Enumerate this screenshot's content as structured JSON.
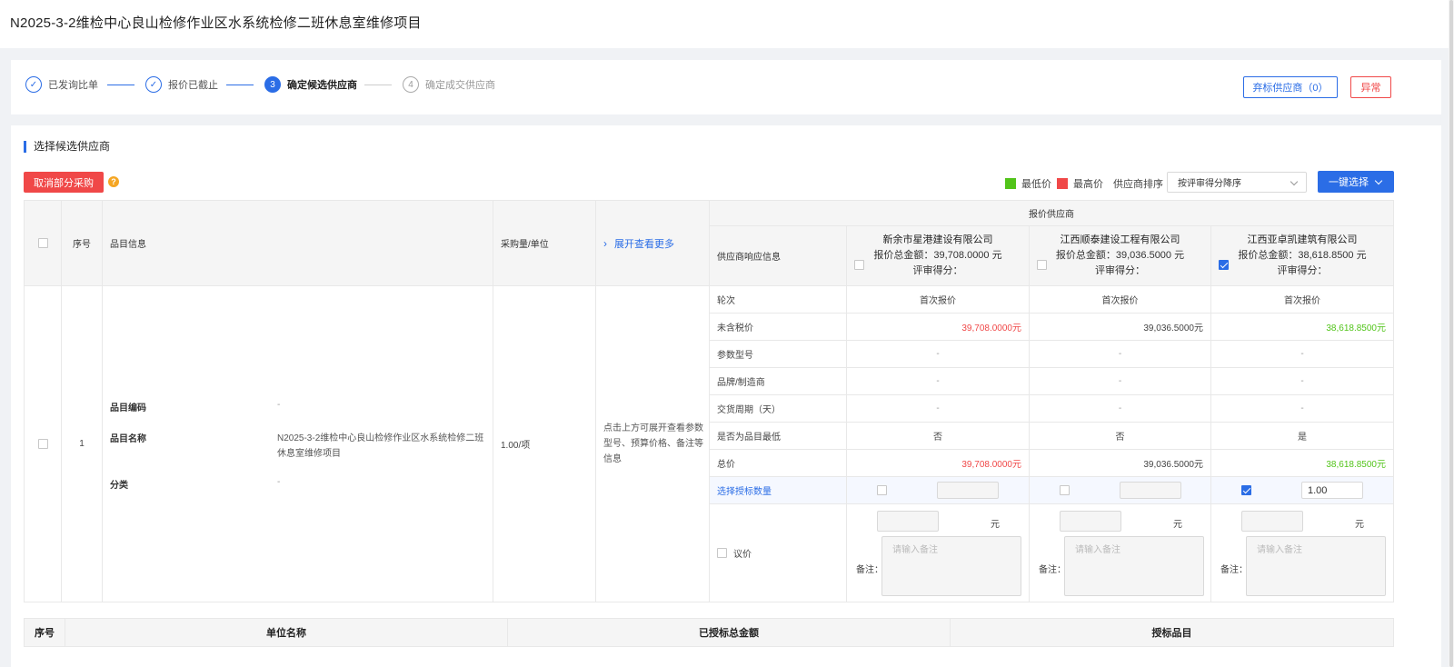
{
  "page": {
    "title": "N2025-3-2维检中心良山检修作业区水系统检修二班休息室维修项目"
  },
  "steps": [
    {
      "label": "已发询比单",
      "marker": "✓",
      "state": "done"
    },
    {
      "label": "报价已截止",
      "marker": "✓",
      "state": "done"
    },
    {
      "label": "确定候选供应商",
      "marker": "3",
      "state": "active"
    },
    {
      "label": "确定成交供应商",
      "marker": "4",
      "state": "todo"
    }
  ],
  "header_actions": {
    "abandon": "弃标供应商（0）",
    "exception": "异常"
  },
  "section": {
    "title": "选择候选供应商"
  },
  "toolbar": {
    "cancel_partial": "取消部分采购",
    "help": "?",
    "legend_low": "最低价",
    "legend_high": "最高价",
    "sort_label": "供应商排序",
    "sort_value": "按评审得分降序",
    "one_click": "一键选择"
  },
  "colors": {
    "low": "#52c41a",
    "high": "#f04848",
    "accent": "#2b6de6"
  },
  "table": {
    "headers": {
      "seq": "序号",
      "item_info": "品目信息",
      "qty_unit": "采购量/单位",
      "expand_more": "展开查看更多",
      "quote_suppliers": "报价供应商",
      "response_info": "供应商响应信息"
    },
    "suppliers": [
      {
        "name": "新余市星港建设有限公司",
        "total": "报价总金额：39,708.0000 元",
        "score": "评审得分：",
        "checked": false
      },
      {
        "name": "江西顺泰建设工程有限公司",
        "total": "报价总金额：39,036.5000 元",
        "score": "评审得分：",
        "checked": false
      },
      {
        "name": "江西亚卓凯建筑有限公司",
        "total": "报价总金额：38,618.8500 元",
        "score": "评审得分：",
        "checked": true
      }
    ],
    "row": {
      "seq": "1",
      "code_label": "品目编码",
      "code_value": "-",
      "name_label": "品目名称",
      "name_value": "N2025-3-2维检中心良山检修作业区水系统检修二班休息室维修项目",
      "category_label": "分类",
      "category_value": "-",
      "qty": "1.00/项",
      "expand_hint": "点击上方可展开查看参数型号、预算价格、备注等信息"
    },
    "attr_rows": [
      {
        "label": "轮次",
        "values": [
          "首次报价",
          "首次报价",
          "首次报价"
        ],
        "align": "center",
        "tone": [
          "",
          "",
          ""
        ]
      },
      {
        "label": "未含税价",
        "values": [
          "39,708.0000元",
          "39,036.5000元",
          "38,618.8500元"
        ],
        "align": "right",
        "tone": [
          "red",
          "",
          "green"
        ]
      },
      {
        "label": "参数型号",
        "values": [
          "-",
          "-",
          "-"
        ],
        "align": "center",
        "tone": [
          "gray",
          "gray",
          "gray"
        ]
      },
      {
        "label": "品牌/制造商",
        "values": [
          "-",
          "-",
          "-"
        ],
        "align": "center",
        "tone": [
          "gray",
          "gray",
          "gray"
        ]
      },
      {
        "label": "交货周期（天）",
        "values": [
          "-",
          "-",
          "-"
        ],
        "align": "center",
        "tone": [
          "gray",
          "gray",
          "gray"
        ]
      },
      {
        "label": "是否为品目最低",
        "values": [
          "否",
          "否",
          "是"
        ],
        "align": "center",
        "tone": [
          "",
          "",
          ""
        ]
      },
      {
        "label": "总价",
        "values": [
          "39,708.0000元",
          "39,036.5000元",
          "38,618.8500元"
        ],
        "align": "right",
        "tone": [
          "red",
          "",
          "green"
        ]
      }
    ],
    "award_qty": {
      "label": "选择授标数量",
      "values": [
        "",
        "",
        "1.00"
      ],
      "checked": [
        false,
        false,
        true
      ]
    },
    "negotiate": {
      "label": "议价",
      "yuan": "元",
      "remark_label": "备注：",
      "remark_placeholder": "请输入备注"
    }
  },
  "summary": {
    "headers": [
      "序号",
      "单位名称",
      "已授标总金额",
      "授标品目"
    ]
  }
}
